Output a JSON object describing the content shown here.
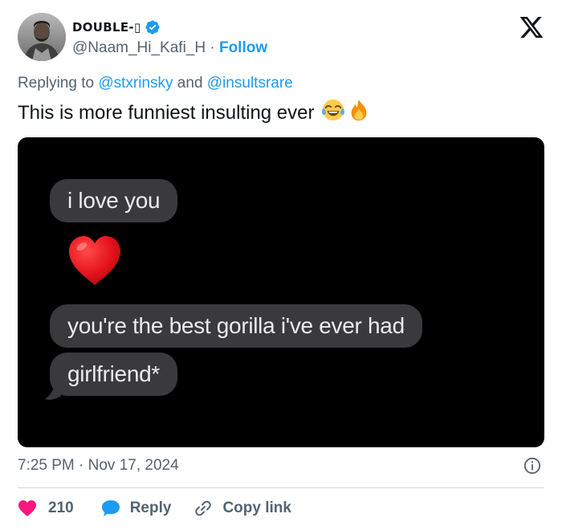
{
  "author": {
    "display_name": "DOUBLE-▯",
    "handle": "@Naam_Hi_Kafi_H",
    "separator": " · ",
    "follow_label": "Follow",
    "verified": true
  },
  "reply_context": {
    "prefix": "Replying to ",
    "mention_1": "@stxrinsky",
    "conjunction": " and ",
    "mention_2": "@insultsrare"
  },
  "tweet": {
    "text": "This is more funniest insulting ever",
    "emojis": [
      "face-with-tears-of-joy",
      "fire"
    ]
  },
  "media": {
    "messages": [
      "i love you",
      "you're the best gorilla i've ever had",
      "girlfriend*"
    ],
    "heart_emoji": "red-heart"
  },
  "meta": {
    "timestamp": "7:25 PM · Nov 17, 2024"
  },
  "actions": {
    "like_count": "210",
    "reply_label": "Reply",
    "copy_link_label": "Copy link"
  },
  "colors": {
    "accent": "#1d9bf0",
    "like": "#f91880",
    "secondary_text": "#536471",
    "primary_text": "#0f1419"
  }
}
